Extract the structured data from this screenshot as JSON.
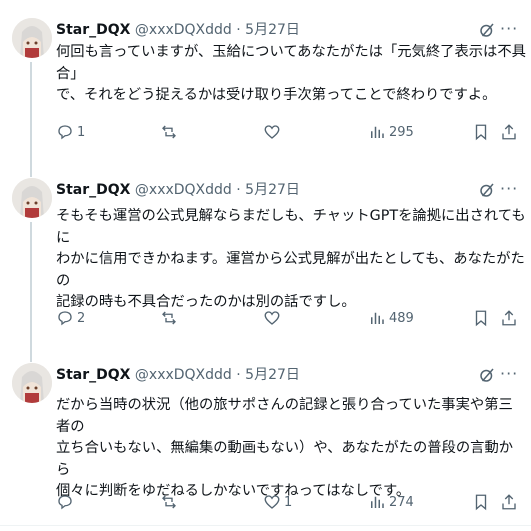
{
  "tweets": [
    {
      "name": "Star_DQX",
      "handle": "@xxxDQXddd",
      "sep": "·",
      "date": "5月27日",
      "lines": [
        "何回も言っていますが、玉給についてあなたがたは「元気終了表示は不具合」",
        "で、それをどう捉えるかは受け取り手次第ってことで終わりですよ。"
      ],
      "replies": "1",
      "reposts": "",
      "likes": "",
      "views": "295"
    },
    {
      "name": "Star_DQX",
      "handle": "@xxxDQXddd",
      "sep": "·",
      "date": "5月27日",
      "lines": [
        "そもそも運営の公式見解ならまだしも、チャットGPTを論拠に出されてもに",
        "わかに信用できかねます。運営から公式見解が出たとしても、あなたがたの",
        "記録の時も不具合だったのかは別の話ですし。"
      ],
      "replies": "2",
      "reposts": "",
      "likes": "",
      "views": "489"
    },
    {
      "name": "Star_DQX",
      "handle": "@xxxDQXddd",
      "sep": "·",
      "date": "5月27日",
      "lines": [
        "だから当時の状況（他の旅サポさんの記録と張り合っていた事実や第三者の",
        "立ち合いもない、無編集の動画もない）や、あなたがたの普段の言動から",
        "個々に判断をゆだねるしかないですねってはなしです。"
      ],
      "replies": "",
      "reposts": "",
      "likes": "1",
      "views": "274"
    }
  ],
  "icons": {
    "reply": "reply-icon",
    "repost": "repost-icon",
    "like": "like-icon",
    "views": "views-icon",
    "bookmark": "bookmark-icon",
    "share": "share-icon",
    "grok": "grok-icon",
    "more": "more-icon"
  },
  "colors": {
    "text": "#0f1419",
    "secondary": "#536471",
    "line": "#cfd9de"
  }
}
